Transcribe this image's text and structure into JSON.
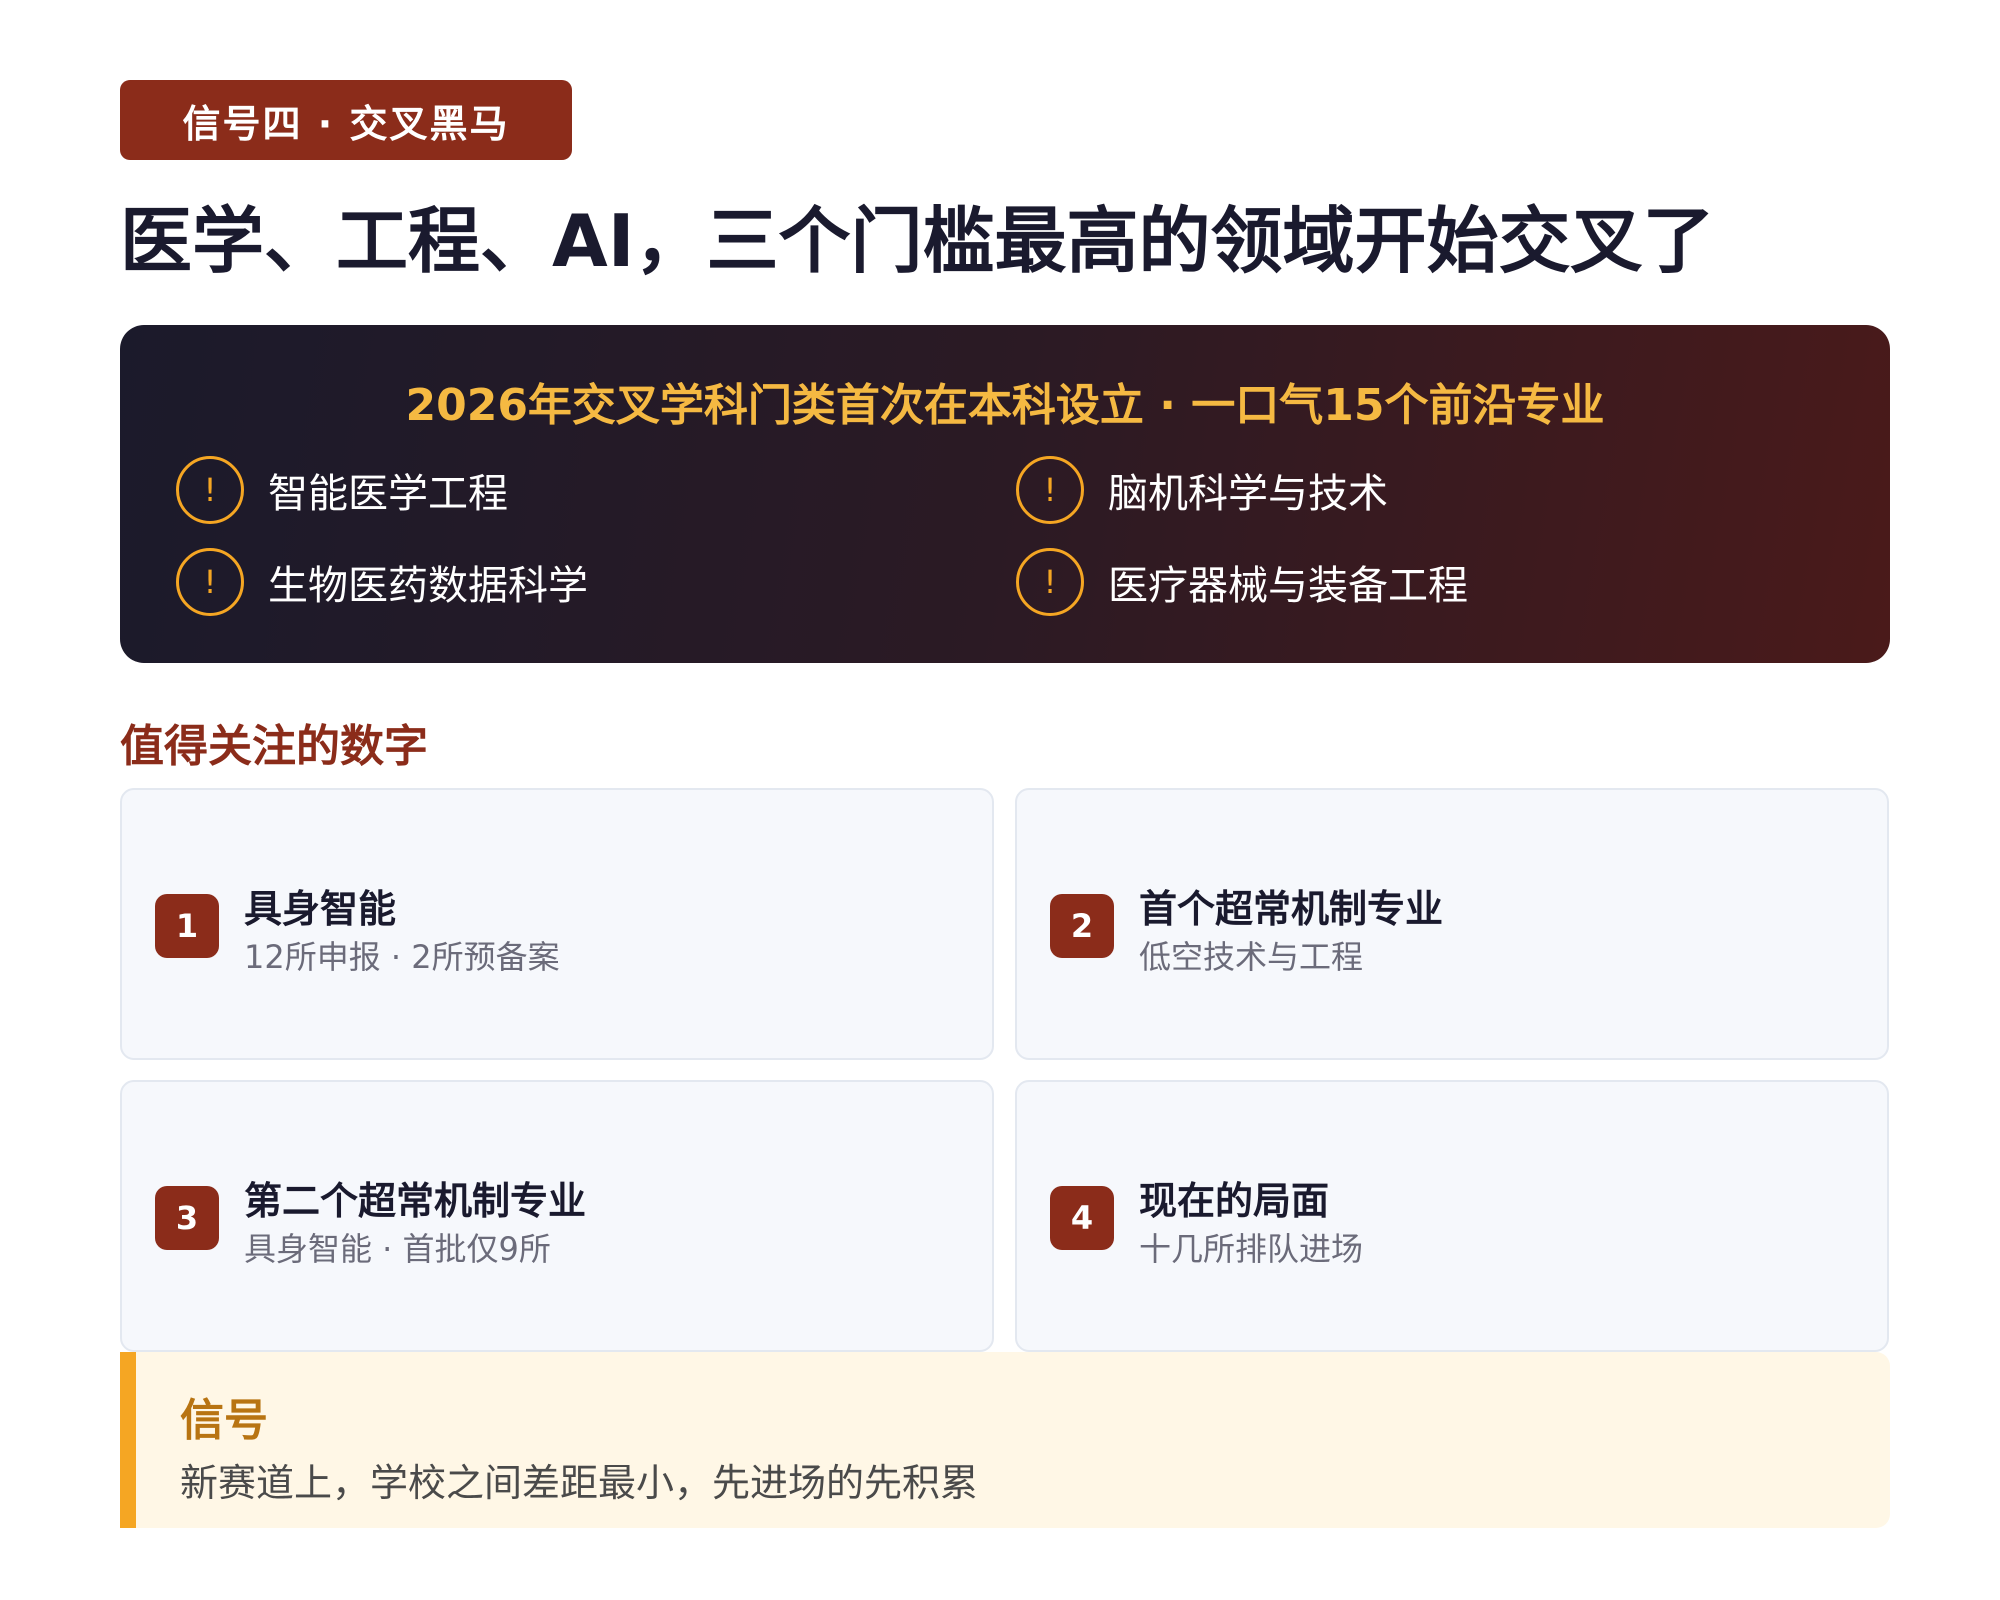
{
  "tag": "信号四 · 交叉黑马",
  "title": "医学、工程、AI，三个门槛最高的领域开始交叉了",
  "highlight": {
    "headline": "2026年交叉学科门类首次在本科设立 · 一口气15个前沿专业",
    "icon_glyph": "!",
    "items": [
      "智能医学工程",
      "脑机科学与技术",
      "生物医药数据科学",
      "医疗器械与装备工程"
    ]
  },
  "section_title": "值得关注的数字",
  "stats": [
    {
      "num": "1",
      "title": "具身智能",
      "sub": "12所申报 · 2所预备案"
    },
    {
      "num": "2",
      "title": "首个超常机制专业",
      "sub": "低空技术与工程"
    },
    {
      "num": "3",
      "title": "第二个超常机制专业",
      "sub": "具身智能 · 首批仅9所"
    },
    {
      "num": "4",
      "title": "现在的局面",
      "sub": "十几所排队进场"
    }
  ],
  "callout": {
    "title": "信号",
    "text": "新赛道上，学校之间差距最小，先进场的先积累"
  },
  "colors": {
    "brand": "#8b2c1a",
    "accent": "#f5a623",
    "headline": "#f5b942"
  }
}
